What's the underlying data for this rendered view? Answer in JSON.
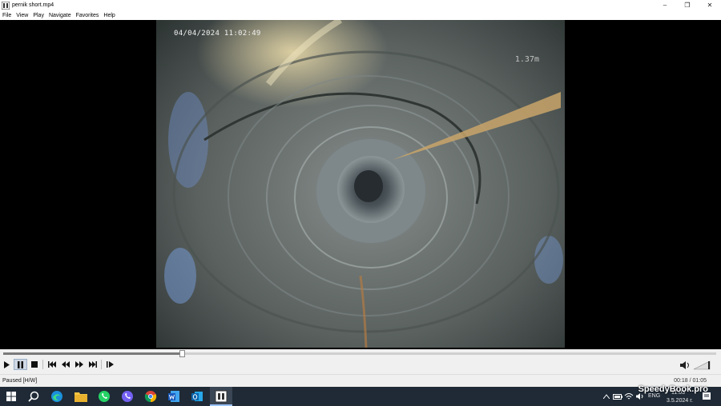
{
  "window": {
    "title": "pernik short.mp4",
    "minimize": "–",
    "restore": "❐",
    "close": "✕"
  },
  "menu": [
    "File",
    "View",
    "Play",
    "Navigate",
    "Favorites",
    "Help"
  ],
  "video": {
    "osd_datetime": "04/04/2024 11:02:49",
    "osd_depth": "1.37m"
  },
  "player": {
    "progress": 0.25,
    "status": "Paused [H/W]",
    "time": "00:18 / 01:05"
  },
  "taskbar": {
    "language": "ENG",
    "date": "3.5.2024 г.",
    "time": "11:03"
  },
  "watermark": "SpeedyBook.pro"
}
